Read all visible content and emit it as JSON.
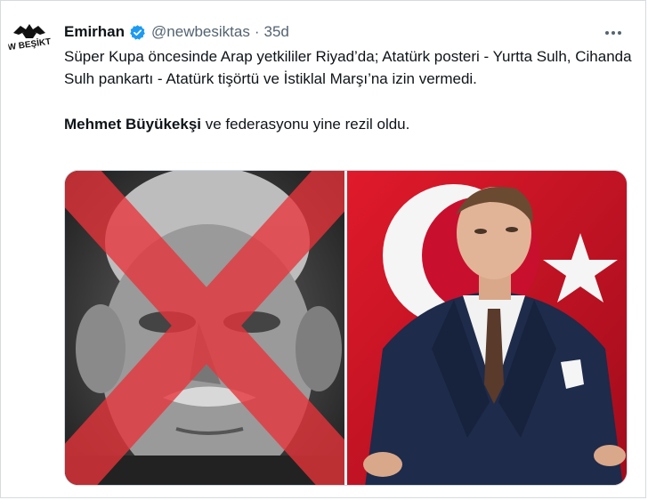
{
  "author": {
    "display_name": "Emirhan",
    "handle": "@newbesiktas",
    "separator": "·",
    "timestamp": "35d",
    "verified": true,
    "avatar_icon": "besiktas-eagle-logo-icon",
    "avatar_text": "NEW BEŞİKTAŞ"
  },
  "tweet": {
    "paragraph1": "Süper Kupa öncesinde Arap yetkililer Riyad’da; Atatürk posteri - Yurtta Sulh, Cihanda Sulh pankartı - Atatürk tişörtü ve İstiklal Marşı’na izin vermedi.",
    "mention_name": "Mehmet Büyükekşi",
    "paragraph2_rest": " ve federasyonu yine rezil oldu."
  },
  "actions": {
    "more_icon": "more-horizontal-icon"
  },
  "colors": {
    "verified_blue": "#1d9bf0",
    "flag_red": "#c8102e",
    "cross_red": "#e8343a",
    "secondary_text": "#536471"
  }
}
